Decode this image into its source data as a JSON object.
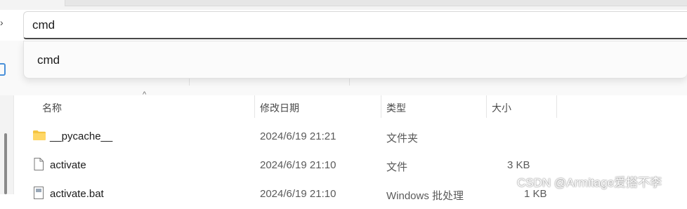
{
  "address_bar": {
    "value": "cmd"
  },
  "autocomplete": {
    "items": [
      {
        "label": "cmd"
      }
    ]
  },
  "columns": [
    {
      "label": "名称"
    },
    {
      "label": "修改日期"
    },
    {
      "label": "类型"
    },
    {
      "label": "大小"
    }
  ],
  "sort_indicator": "^",
  "files": [
    {
      "name": "__pycache__",
      "modified": "2024/6/19 21:21",
      "type": "文件夹",
      "size": "",
      "icon": "folder-icon"
    },
    {
      "name": "activate",
      "modified": "2024/6/19 21:10",
      "type": "文件",
      "size": "3 KB",
      "icon": "file-icon"
    },
    {
      "name": "activate.bat",
      "modified": "2024/6/19 21:10",
      "type": "Windows 批处理",
      "size": "1 KB",
      "icon": "batch-file-icon"
    }
  ],
  "watermark": "CSDN @Armitage爱搭不李",
  "colors": {
    "folder": "#f5c542",
    "accent_border": "#4a4a4a",
    "left_icon": "#4a90d9"
  }
}
